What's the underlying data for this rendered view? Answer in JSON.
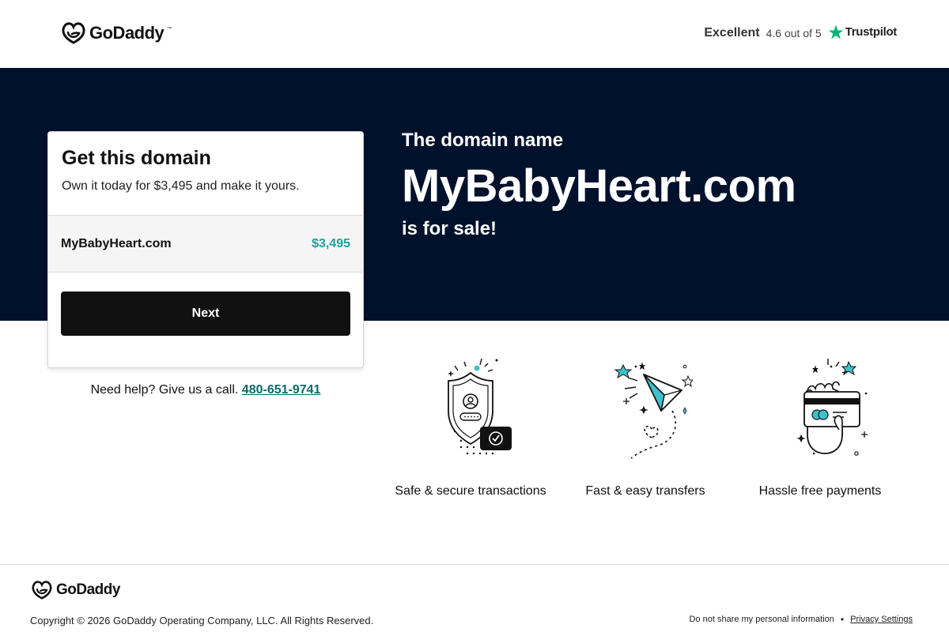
{
  "header": {
    "brand": "GoDaddy",
    "rating": {
      "label": "Excellent",
      "score_text": "4.6 out of 5",
      "provider": "Trustpilot",
      "star_icon": "star-icon",
      "star_color": "#00b67a"
    }
  },
  "hero": {
    "pre_text": "The domain name",
    "domain": "MyBabyHeart.com",
    "post_text": "is for sale!",
    "background": "#00112c"
  },
  "card": {
    "title": "Get this domain",
    "subtitle": "Own it today for $3,495 and make it yours.",
    "domain": "MyBabyHeart.com",
    "price": "$3,495",
    "price_color": "#1ba39c",
    "button_label": "Next"
  },
  "help": {
    "text": "Need help? Give us a call.",
    "phone": "480-651-9741"
  },
  "features": [
    {
      "icon": "secure-shield-icon",
      "label": "Safe & secure transactions"
    },
    {
      "icon": "paper-plane-icon",
      "label": "Fast & easy transfers"
    },
    {
      "icon": "card-payment-icon",
      "label": "Hassle free payments"
    }
  ],
  "footer": {
    "brand": "GoDaddy",
    "copyright": "Copyright © 2026 GoDaddy Operating Company, LLC. All Rights Reserved.",
    "links": [
      {
        "label": "Do not share my personal information"
      },
      {
        "label": "Privacy Settings"
      }
    ]
  }
}
